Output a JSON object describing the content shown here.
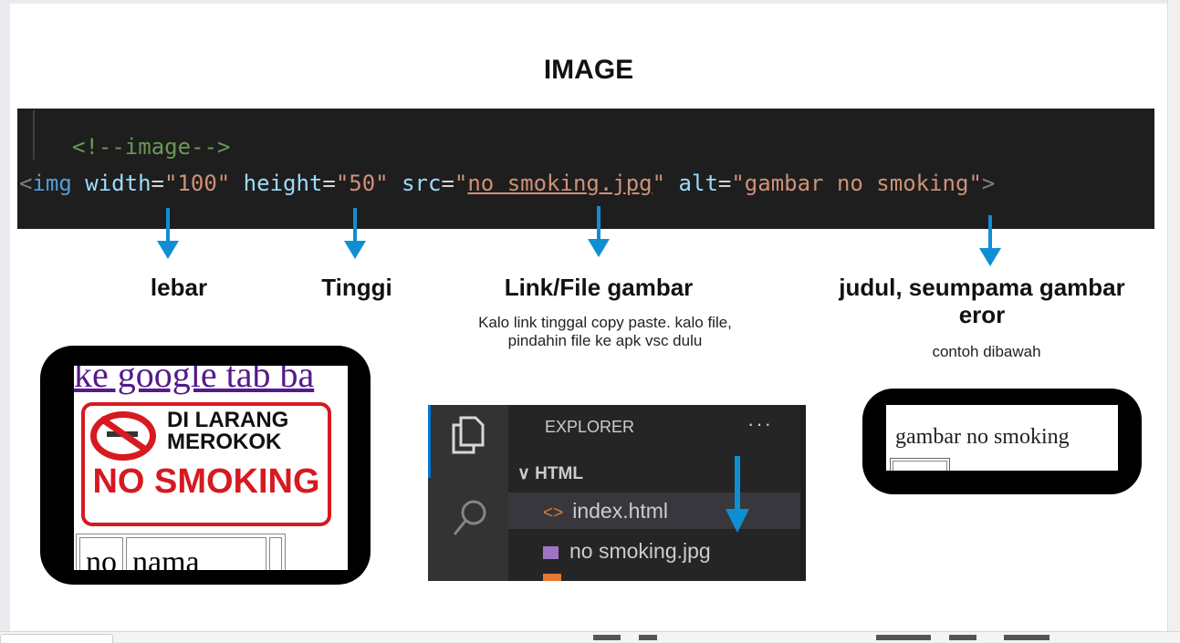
{
  "title": "IMAGE",
  "code": {
    "comment": "<!--image-->",
    "tag_open": "<",
    "tag_name": "img",
    "attr_width": "width",
    "val_width": "\"100\"",
    "attr_height": "height",
    "val_height": "\"50\"",
    "attr_src": "src",
    "q1": "\"",
    "val_src": "no smoking.jpg",
    "attr_alt": "alt",
    "val_alt": "\"gambar no smoking\"",
    "eq": "=",
    "tag_close": ">"
  },
  "labels": {
    "lebar": "lebar",
    "tinggi": "Tinggi",
    "link": "Link/File gambar",
    "judul": "judul, seumpama gambar eror"
  },
  "descriptions": {
    "link": "Kalo link tinggal copy paste. kalo file, pindahin file ke apk vsc dulu",
    "judul": "contoh dibawah"
  },
  "example_render": {
    "link_text": "ke google tab ba",
    "sign_line1": "DI LARANG",
    "sign_line2": "MEROKOK",
    "sign_line3": "NO SMOKING",
    "table_cells": [
      "no",
      "nama",
      ""
    ]
  },
  "vscode": {
    "explorer": "EXPLORER",
    "dots": "···",
    "folder": "∨ HTML",
    "file1_icon": "<>",
    "file1": "index.html",
    "file2": "no smoking.jpg",
    "icons": [
      "files-icon",
      "search-icon",
      "html-file-icon",
      "image-file-icon"
    ]
  },
  "alt_example": {
    "text": "gambar no smoking"
  },
  "colors": {
    "arrow": "#0f8fd3",
    "code_bg": "#1e1e1e",
    "sign_red": "#d71920",
    "frame": "#000000"
  }
}
